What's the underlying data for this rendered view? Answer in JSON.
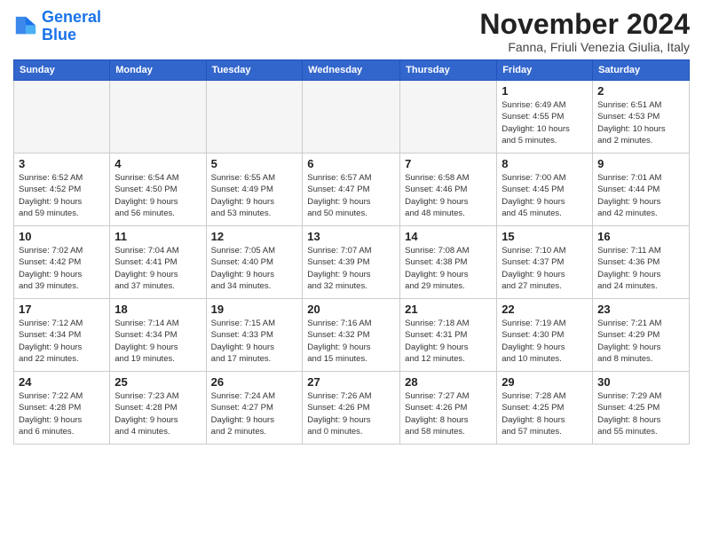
{
  "logo": {
    "line1": "General",
    "line2": "Blue"
  },
  "title": "November 2024",
  "location": "Fanna, Friuli Venezia Giulia, Italy",
  "weekdays": [
    "Sunday",
    "Monday",
    "Tuesday",
    "Wednesday",
    "Thursday",
    "Friday",
    "Saturday"
  ],
  "weeks": [
    [
      {
        "day": "",
        "info": ""
      },
      {
        "day": "",
        "info": ""
      },
      {
        "day": "",
        "info": ""
      },
      {
        "day": "",
        "info": ""
      },
      {
        "day": "",
        "info": ""
      },
      {
        "day": "1",
        "info": "Sunrise: 6:49 AM\nSunset: 4:55 PM\nDaylight: 10 hours\nand 5 minutes."
      },
      {
        "day": "2",
        "info": "Sunrise: 6:51 AM\nSunset: 4:53 PM\nDaylight: 10 hours\nand 2 minutes."
      }
    ],
    [
      {
        "day": "3",
        "info": "Sunrise: 6:52 AM\nSunset: 4:52 PM\nDaylight: 9 hours\nand 59 minutes."
      },
      {
        "day": "4",
        "info": "Sunrise: 6:54 AM\nSunset: 4:50 PM\nDaylight: 9 hours\nand 56 minutes."
      },
      {
        "day": "5",
        "info": "Sunrise: 6:55 AM\nSunset: 4:49 PM\nDaylight: 9 hours\nand 53 minutes."
      },
      {
        "day": "6",
        "info": "Sunrise: 6:57 AM\nSunset: 4:47 PM\nDaylight: 9 hours\nand 50 minutes."
      },
      {
        "day": "7",
        "info": "Sunrise: 6:58 AM\nSunset: 4:46 PM\nDaylight: 9 hours\nand 48 minutes."
      },
      {
        "day": "8",
        "info": "Sunrise: 7:00 AM\nSunset: 4:45 PM\nDaylight: 9 hours\nand 45 minutes."
      },
      {
        "day": "9",
        "info": "Sunrise: 7:01 AM\nSunset: 4:44 PM\nDaylight: 9 hours\nand 42 minutes."
      }
    ],
    [
      {
        "day": "10",
        "info": "Sunrise: 7:02 AM\nSunset: 4:42 PM\nDaylight: 9 hours\nand 39 minutes."
      },
      {
        "day": "11",
        "info": "Sunrise: 7:04 AM\nSunset: 4:41 PM\nDaylight: 9 hours\nand 37 minutes."
      },
      {
        "day": "12",
        "info": "Sunrise: 7:05 AM\nSunset: 4:40 PM\nDaylight: 9 hours\nand 34 minutes."
      },
      {
        "day": "13",
        "info": "Sunrise: 7:07 AM\nSunset: 4:39 PM\nDaylight: 9 hours\nand 32 minutes."
      },
      {
        "day": "14",
        "info": "Sunrise: 7:08 AM\nSunset: 4:38 PM\nDaylight: 9 hours\nand 29 minutes."
      },
      {
        "day": "15",
        "info": "Sunrise: 7:10 AM\nSunset: 4:37 PM\nDaylight: 9 hours\nand 27 minutes."
      },
      {
        "day": "16",
        "info": "Sunrise: 7:11 AM\nSunset: 4:36 PM\nDaylight: 9 hours\nand 24 minutes."
      }
    ],
    [
      {
        "day": "17",
        "info": "Sunrise: 7:12 AM\nSunset: 4:34 PM\nDaylight: 9 hours\nand 22 minutes."
      },
      {
        "day": "18",
        "info": "Sunrise: 7:14 AM\nSunset: 4:34 PM\nDaylight: 9 hours\nand 19 minutes."
      },
      {
        "day": "19",
        "info": "Sunrise: 7:15 AM\nSunset: 4:33 PM\nDaylight: 9 hours\nand 17 minutes."
      },
      {
        "day": "20",
        "info": "Sunrise: 7:16 AM\nSunset: 4:32 PM\nDaylight: 9 hours\nand 15 minutes."
      },
      {
        "day": "21",
        "info": "Sunrise: 7:18 AM\nSunset: 4:31 PM\nDaylight: 9 hours\nand 12 minutes."
      },
      {
        "day": "22",
        "info": "Sunrise: 7:19 AM\nSunset: 4:30 PM\nDaylight: 9 hours\nand 10 minutes."
      },
      {
        "day": "23",
        "info": "Sunrise: 7:21 AM\nSunset: 4:29 PM\nDaylight: 9 hours\nand 8 minutes."
      }
    ],
    [
      {
        "day": "24",
        "info": "Sunrise: 7:22 AM\nSunset: 4:28 PM\nDaylight: 9 hours\nand 6 minutes."
      },
      {
        "day": "25",
        "info": "Sunrise: 7:23 AM\nSunset: 4:28 PM\nDaylight: 9 hours\nand 4 minutes."
      },
      {
        "day": "26",
        "info": "Sunrise: 7:24 AM\nSunset: 4:27 PM\nDaylight: 9 hours\nand 2 minutes."
      },
      {
        "day": "27",
        "info": "Sunrise: 7:26 AM\nSunset: 4:26 PM\nDaylight: 9 hours\nand 0 minutes."
      },
      {
        "day": "28",
        "info": "Sunrise: 7:27 AM\nSunset: 4:26 PM\nDaylight: 8 hours\nand 58 minutes."
      },
      {
        "day": "29",
        "info": "Sunrise: 7:28 AM\nSunset: 4:25 PM\nDaylight: 8 hours\nand 57 minutes."
      },
      {
        "day": "30",
        "info": "Sunrise: 7:29 AM\nSunset: 4:25 PM\nDaylight: 8 hours\nand 55 minutes."
      }
    ]
  ]
}
